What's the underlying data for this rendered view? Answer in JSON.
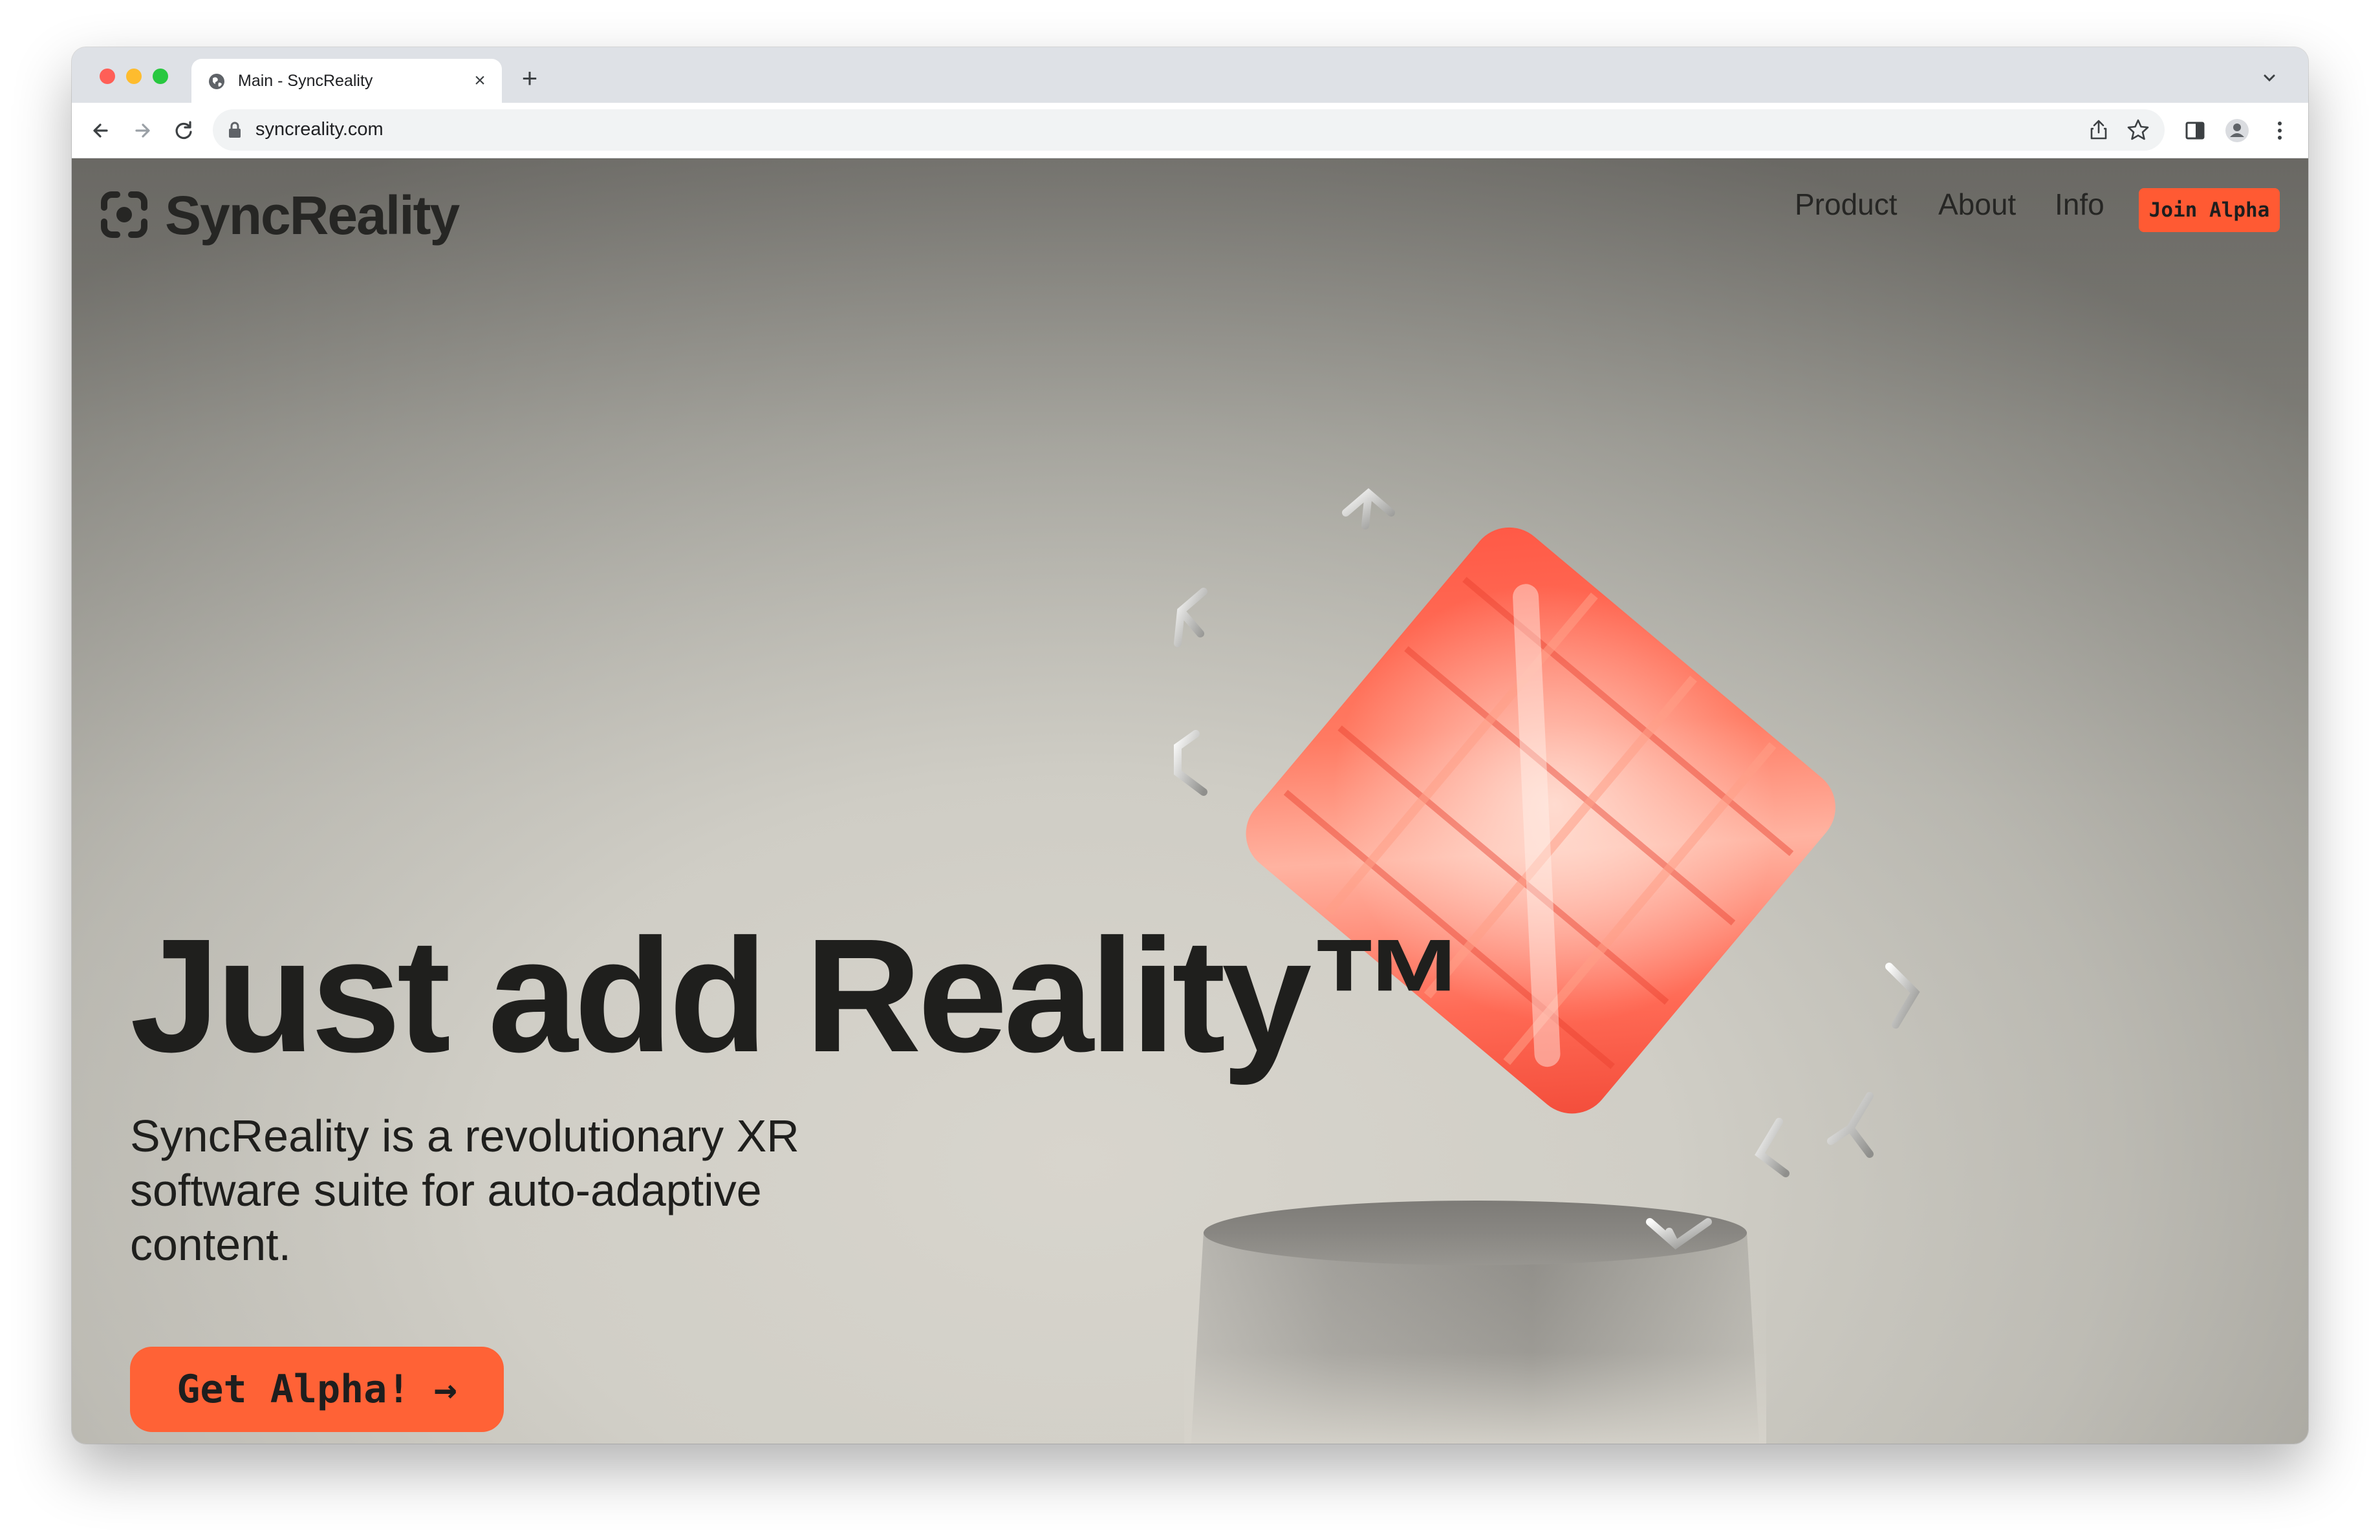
{
  "browser": {
    "tab": {
      "title": "Main - SyncReality",
      "close_icon": "close-icon",
      "favicon_icon": "globe-icon"
    },
    "new_tab_label": "+",
    "address": {
      "url": "syncreality.com",
      "lock_icon": "lock-icon"
    },
    "toolbar_icons": [
      "back-arrow-icon",
      "forward-arrow-icon",
      "reload-icon",
      "share-icon",
      "star-icon",
      "side-panel-icon",
      "profile-icon",
      "kebab-menu-icon"
    ]
  },
  "site": {
    "logo": {
      "text": "SyncReality",
      "icon": "syncreality-logo-icon"
    },
    "nav": [
      {
        "label": "Product"
      },
      {
        "label": "About"
      },
      {
        "label": "Info"
      }
    ],
    "join_button": "Join Alpha",
    "hero": {
      "headline": "Just add Reality™",
      "subcopy": "SyncReality is a revolutionary XR software suite for auto-adaptive content.",
      "cta": "Get Alpha! →"
    },
    "colors": {
      "accent": "#ff6236",
      "text": "#1f1f1d",
      "object": "#ff5a45"
    }
  }
}
